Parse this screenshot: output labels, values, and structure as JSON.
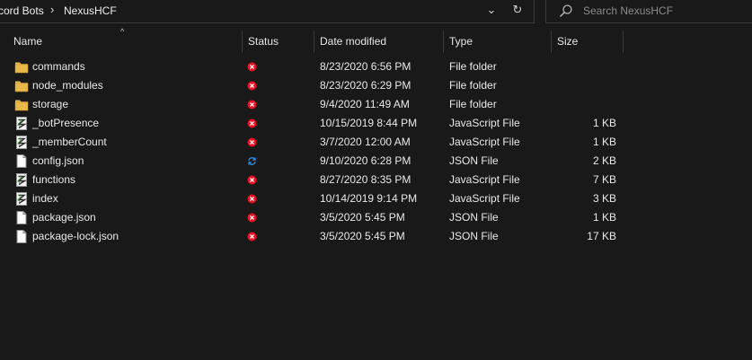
{
  "breadcrumb": {
    "parent": "cord Bots",
    "separator": "›",
    "current": "NexusHCF"
  },
  "address_controls": {
    "dropdown": "⌄",
    "refresh": "↻"
  },
  "search": {
    "placeholder": "Search NexusHCF"
  },
  "columns": {
    "name": "Name",
    "status": "Status",
    "date": "Date modified",
    "type": "Type",
    "size": "Size"
  },
  "colors": {
    "folder": "#e8b84a",
    "status_error": "#e81123",
    "status_sync": "#2b88d8",
    "background": "#191919"
  },
  "files": [
    {
      "name": "commands",
      "icon": "folder-icon",
      "status": "error-status-icon",
      "date": "8/23/2020 6:56 PM",
      "type": "File folder",
      "size": ""
    },
    {
      "name": "node_modules",
      "icon": "folder-icon",
      "status": "error-status-icon",
      "date": "8/23/2020 6:29 PM",
      "type": "File folder",
      "size": ""
    },
    {
      "name": "storage",
      "icon": "folder-icon",
      "status": "error-status-icon",
      "date": "9/4/2020 11:49 AM",
      "type": "File folder",
      "size": ""
    },
    {
      "name": "_botPresence",
      "icon": "javascript-file-icon",
      "status": "error-status-icon",
      "date": "10/15/2019 8:44 PM",
      "type": "JavaScript File",
      "size": "1 KB"
    },
    {
      "name": "_memberCount",
      "icon": "javascript-file-icon",
      "status": "error-status-icon",
      "date": "3/7/2020 12:00 AM",
      "type": "JavaScript File",
      "size": "1 KB"
    },
    {
      "name": "config.json",
      "icon": "document-icon",
      "status": "sync-status-icon",
      "date": "9/10/2020 6:28 PM",
      "type": "JSON File",
      "size": "2 KB"
    },
    {
      "name": "functions",
      "icon": "javascript-file-icon",
      "status": "error-status-icon",
      "date": "8/27/2020 8:35 PM",
      "type": "JavaScript File",
      "size": "7 KB"
    },
    {
      "name": "index",
      "icon": "javascript-file-icon",
      "status": "error-status-icon",
      "date": "10/14/2019 9:14 PM",
      "type": "JavaScript File",
      "size": "3 KB"
    },
    {
      "name": "package.json",
      "icon": "document-icon",
      "status": "error-status-icon",
      "date": "3/5/2020 5:45 PM",
      "type": "JSON File",
      "size": "1 KB"
    },
    {
      "name": "package-lock.json",
      "icon": "document-icon",
      "status": "error-status-icon",
      "date": "3/5/2020 5:45 PM",
      "type": "JSON File",
      "size": "17 KB"
    }
  ]
}
